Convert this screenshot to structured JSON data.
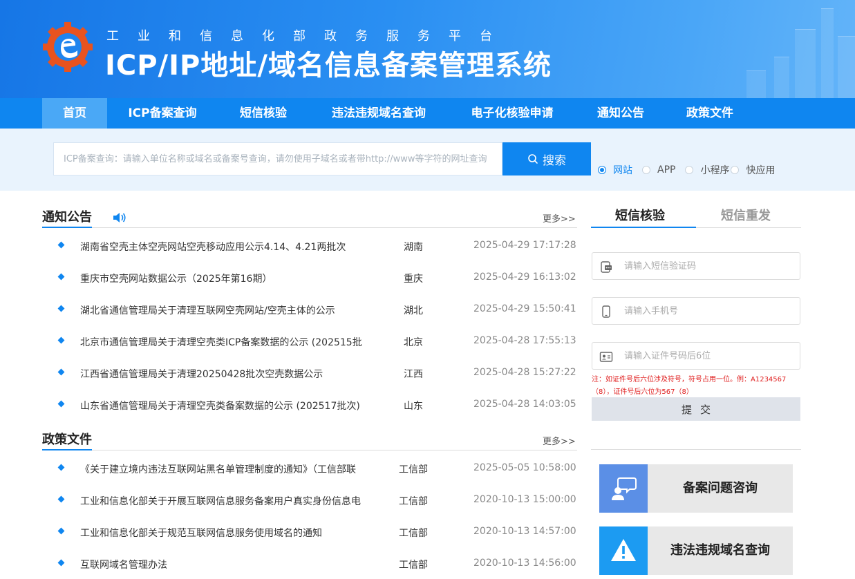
{
  "header": {
    "subtitle": "工业和信息化部政务服务平台",
    "title": "ICP/IP地址/域名信息备案管理系统"
  },
  "nav": [
    "首页",
    "ICP备案查询",
    "短信核验",
    "违法违规域名查询",
    "电子化核验申请",
    "通知公告",
    "政策文件"
  ],
  "search": {
    "placeholder": "ICP备案查询：请输入单位名称或域名或备案号查询，请勿使用子域名或者带http://www等字符的网址查询",
    "button": "搜索",
    "options": [
      "网站",
      "APP",
      "小程序",
      "快应用"
    ],
    "selected": "网站"
  },
  "notices": {
    "title": "通知公告",
    "more": "更多>>",
    "items": [
      {
        "title": "湖南省空壳主体空壳网站空壳移动应用公示4.14、4.21两批次",
        "region": "湖南",
        "date": "2025-04-29 17:17:28"
      },
      {
        "title": "重庆市空壳网站数据公示（2025年第16期）",
        "region": "重庆",
        "date": "2025-04-29 16:13:02"
      },
      {
        "title": "湖北省通信管理局关于清理互联网空壳网站/空壳主体的公示",
        "region": "湖北",
        "date": "2025-04-29 15:50:41"
      },
      {
        "title": "北京市通信管理局关于清理空壳类ICP备案数据的公示 (202515批",
        "region": "北京",
        "date": "2025-04-28 17:55:13"
      },
      {
        "title": "江西省通信管理局关于清理20250428批次空壳数据公示",
        "region": "江西",
        "date": "2025-04-28 15:27:22"
      },
      {
        "title": "山东省通信管理局关于清理空壳类备案数据的公示 (202517批次)",
        "region": "山东",
        "date": "2025-04-28 14:03:05"
      }
    ]
  },
  "policies": {
    "title": "政策文件",
    "more": "更多>>",
    "items": [
      {
        "title": "《关于建立境内违法互联网站黑名单管理制度的通知》（工信部联",
        "dept": "工信部",
        "date": "2025-05-05 10:58:00"
      },
      {
        "title": "工业和信息化部关于开展互联网信息服务备案用户真实身份信息电",
        "dept": "工信部",
        "date": "2020-10-13 15:00:00"
      },
      {
        "title": "工业和信息化部关于规范互联网信息服务使用域名的通知",
        "dept": "工信部",
        "date": "2020-10-13 14:57:00"
      },
      {
        "title": "互联网域名管理办法",
        "dept": "工信部",
        "date": "2020-10-13 14:56:00"
      }
    ]
  },
  "sms": {
    "tab_active": "短信核验",
    "tab_inactive": "短信重发",
    "code_placeholder": "请输入短信验证码",
    "phone_placeholder": "请输入手机号",
    "id_placeholder": "请输入证件号码后6位",
    "note_line1": "注：如证件号后六位涉及符号，符号占用一位。例：A1234567",
    "note_line2": "（8），证件号后六位为567（8）",
    "submit": "提交"
  },
  "cards": {
    "consult": "备案问题咨询",
    "illegal": "违法违规域名查询"
  },
  "colors": {
    "primary": "#0f86f0",
    "nav_active": "#4aa8f6",
    "search_band": "#e9f3fd",
    "note_red": "#e02020",
    "consult_icon_bg": "#5b8fe6",
    "warning_icon_bg": "#1c9bf2"
  }
}
